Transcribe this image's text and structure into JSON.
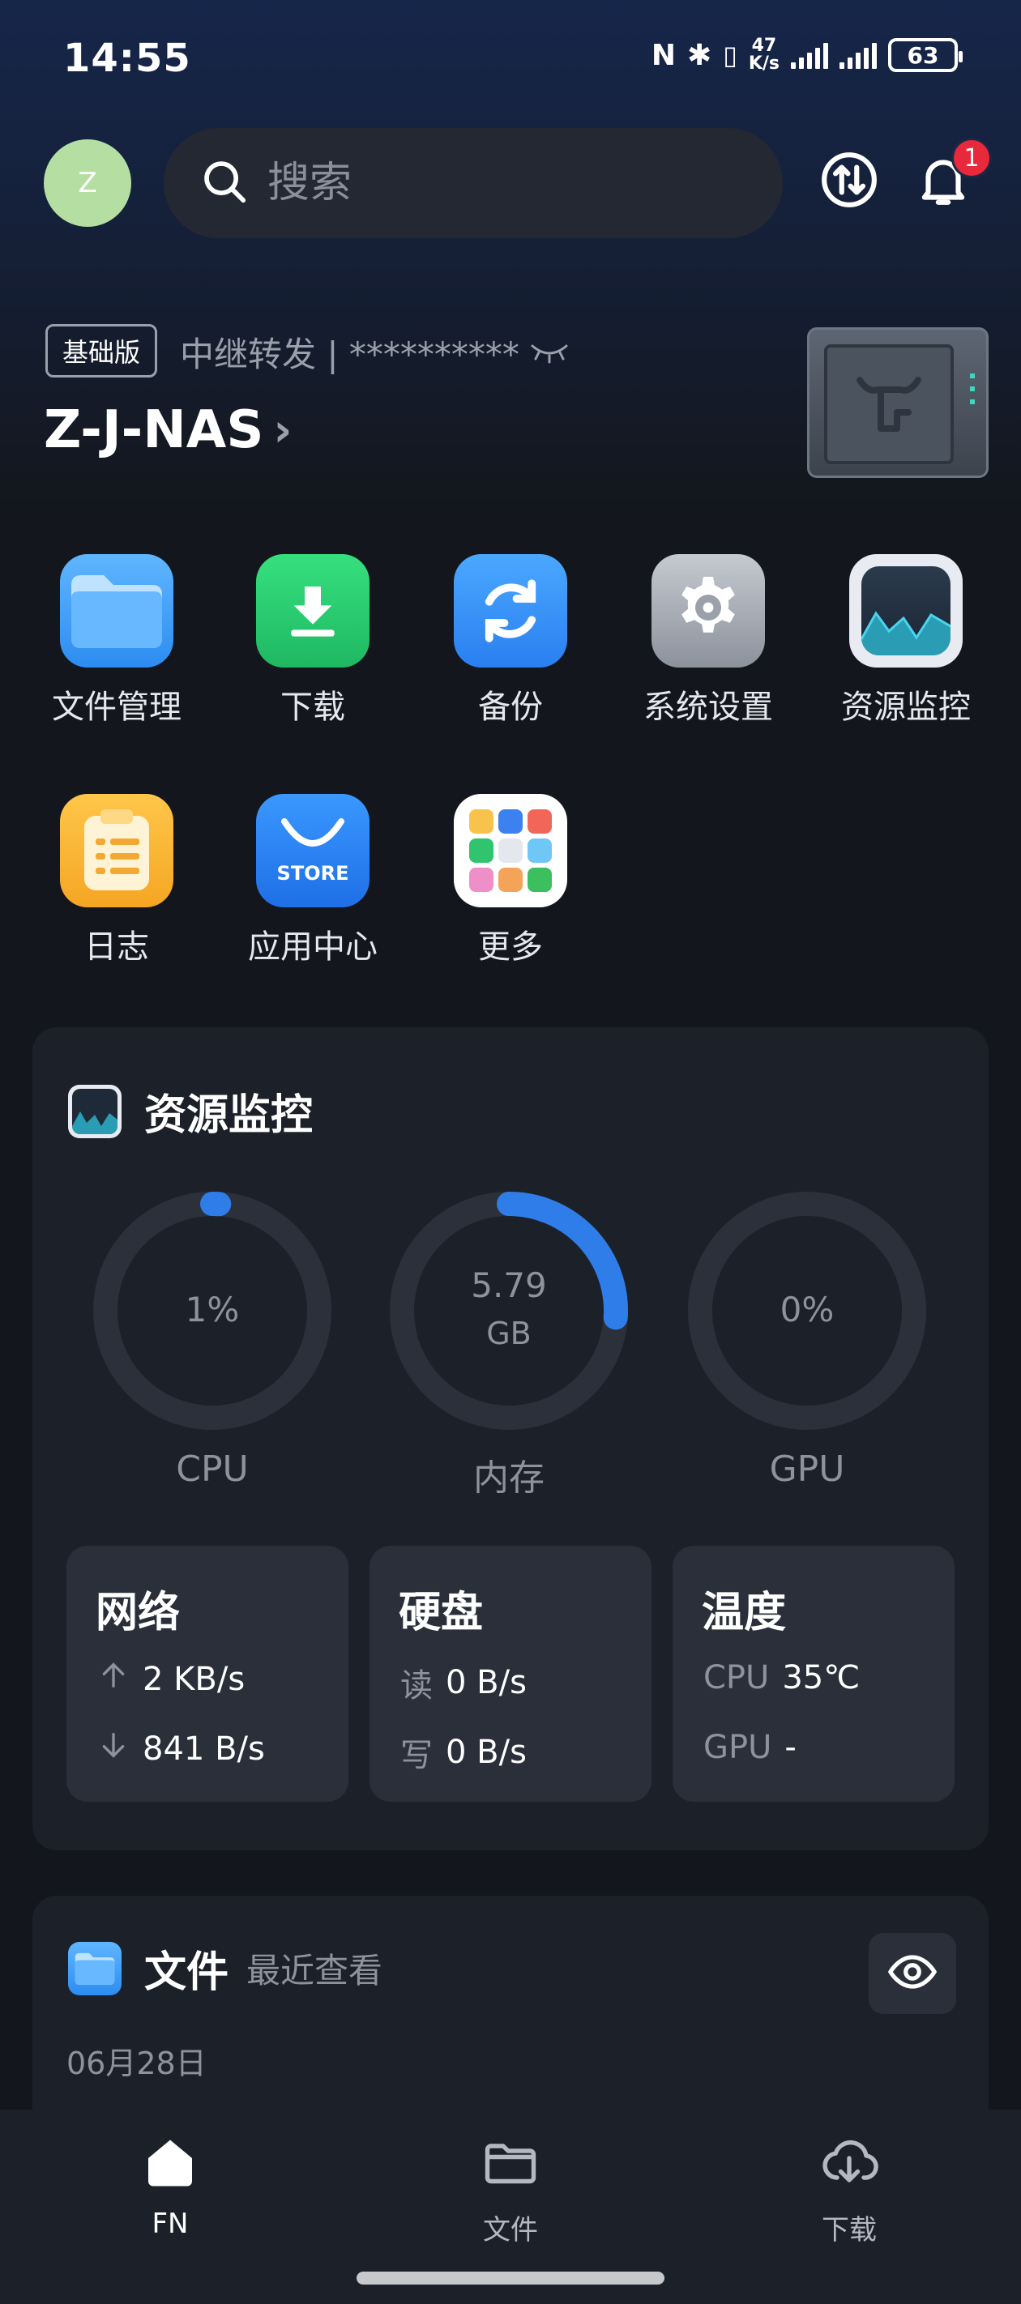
{
  "status_bar": {
    "time": "14:55",
    "net_speed_value": "47",
    "net_speed_unit": "K/s",
    "battery": "63"
  },
  "header": {
    "avatar_letter": "Z",
    "search_placeholder": "搜索",
    "notification_count": "1"
  },
  "device": {
    "edition": "基础版",
    "relay_text": "中继转发 | **********",
    "name": "Z-J-NAS",
    "chevron": "›"
  },
  "apps": [
    {
      "label": "文件管理",
      "icon": "folder-icon"
    },
    {
      "label": "下载",
      "icon": "download-icon"
    },
    {
      "label": "备份",
      "icon": "sync-icon"
    },
    {
      "label": "系统设置",
      "icon": "gear-icon"
    },
    {
      "label": "资源监控",
      "icon": "monitor-icon"
    },
    {
      "label": "日志",
      "icon": "clipboard-icon"
    },
    {
      "label": "应用中心",
      "icon": "store-icon",
      "icon_text": "STORE"
    },
    {
      "label": "更多",
      "icon": "grid-icon"
    }
  ],
  "resource_monitor": {
    "title": "资源监控",
    "gauges": [
      {
        "label": "CPU",
        "value_text": "1%",
        "fraction": 0.01
      },
      {
        "label": "内存",
        "value_text": "5.79",
        "unit": "GB",
        "fraction": 0.26
      },
      {
        "label": "GPU",
        "value_text": "0%",
        "fraction": 0
      }
    ],
    "network": {
      "title": "网络",
      "up": "2 KB/s",
      "down": "841 B/s"
    },
    "disk": {
      "title": "硬盘",
      "read_label": "读",
      "read": "0 B/s",
      "write_label": "写",
      "write": "0 B/s"
    },
    "temperature": {
      "title": "温度",
      "cpu_label": "CPU",
      "cpu": "35℃",
      "gpu_label": "GPU",
      "gpu": "-"
    }
  },
  "files": {
    "title": "文件",
    "subtitle": "最近查看",
    "date": "06月28日"
  },
  "bottom_nav": [
    {
      "label": "FN",
      "icon": "home-icon",
      "active": true
    },
    {
      "label": "文件",
      "icon": "folder-outline-icon",
      "active": false
    },
    {
      "label": "下载",
      "icon": "cloud-download-icon",
      "active": false
    }
  ],
  "colors": {
    "accent": "#2f7de8",
    "background": "#13161c",
    "card": "#1c2029",
    "badge": "#e8293b"
  }
}
